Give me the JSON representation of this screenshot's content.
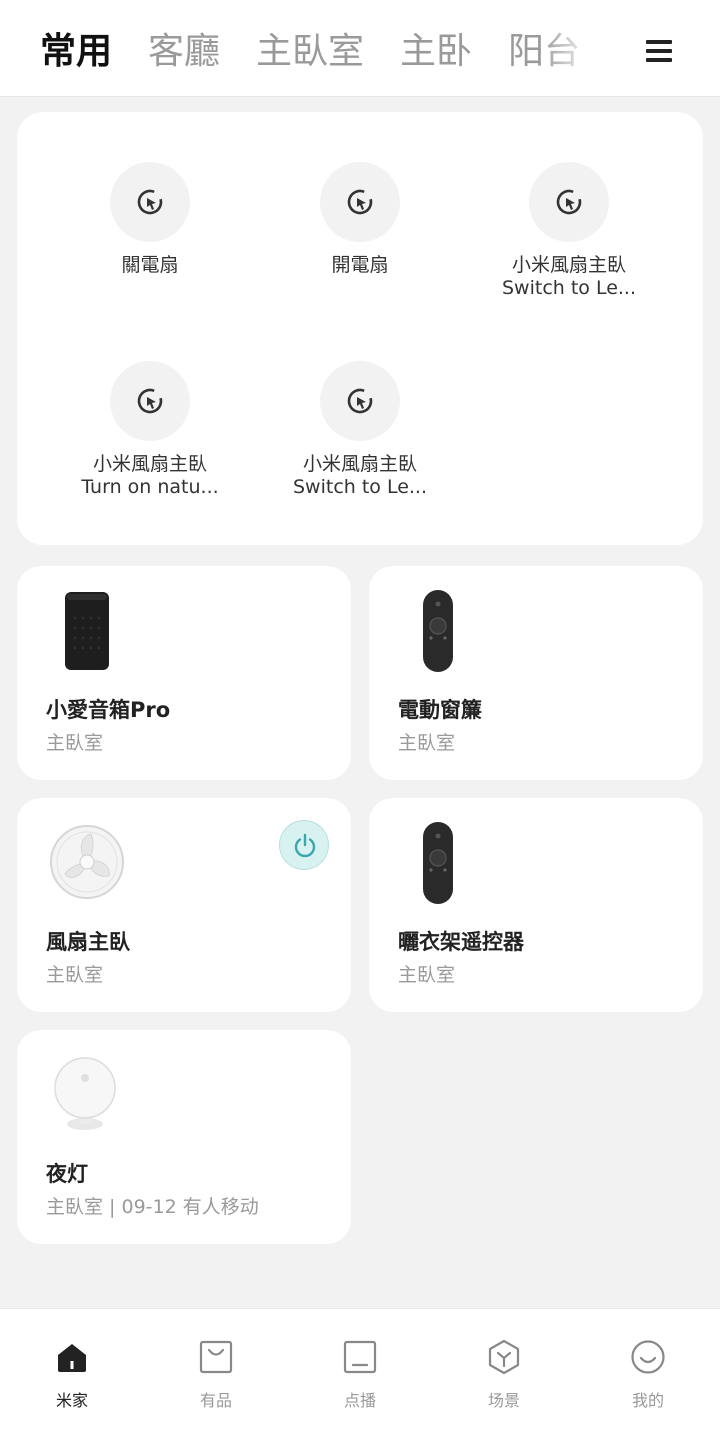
{
  "header": {
    "tabs": [
      "常用",
      "客廳",
      "主臥室",
      "主卧",
      "阳台",
      "阝"
    ],
    "active_tab": 0,
    "menu_icon": "hamburger-menu-icon"
  },
  "scenes": [
    {
      "line1": "關電扇",
      "line2": "",
      "icon": "cursor-click-icon"
    },
    {
      "line1": "開電扇",
      "line2": "",
      "icon": "cursor-click-icon"
    },
    {
      "line1": "小米風扇主臥",
      "line2": "Switch to Le...",
      "icon": "cursor-click-icon"
    },
    {
      "line1": "小米風扇主臥",
      "line2": "Turn on natu...",
      "icon": "cursor-click-icon"
    },
    {
      "line1": "小米風扇主臥",
      "line2": "Switch to Le...",
      "icon": "cursor-click-icon"
    }
  ],
  "devices": [
    {
      "name": "小愛音箱Pro",
      "room": "主臥室",
      "image": "smart-speaker"
    },
    {
      "name": "電動窗簾",
      "room": "主臥室",
      "image": "remote-control"
    },
    {
      "name": "風扇主臥",
      "room": "主臥室",
      "image": "fan",
      "power_icon": "power-icon"
    },
    {
      "name": "曬衣架遥控器",
      "room": "主臥室",
      "image": "remote-control"
    },
    {
      "name": "夜灯",
      "room": "主臥室 | 09-12 有人移动",
      "image": "night-light"
    }
  ],
  "bottom_nav": [
    {
      "label": "米家",
      "icon": "home-icon",
      "active": true
    },
    {
      "label": "有品",
      "icon": "shopping-bag-icon",
      "active": false
    },
    {
      "label": "点播",
      "icon": "media-icon",
      "active": false
    },
    {
      "label": "场景",
      "icon": "cube-icon",
      "active": false
    },
    {
      "label": "我的",
      "icon": "smiley-face-icon",
      "active": false
    }
  ],
  "colors": {
    "background": "#f2f2f2",
    "card": "#ffffff",
    "power_accent": "#3aa7ad",
    "text_primary": "#222222",
    "text_secondary": "#9a9a9a"
  }
}
